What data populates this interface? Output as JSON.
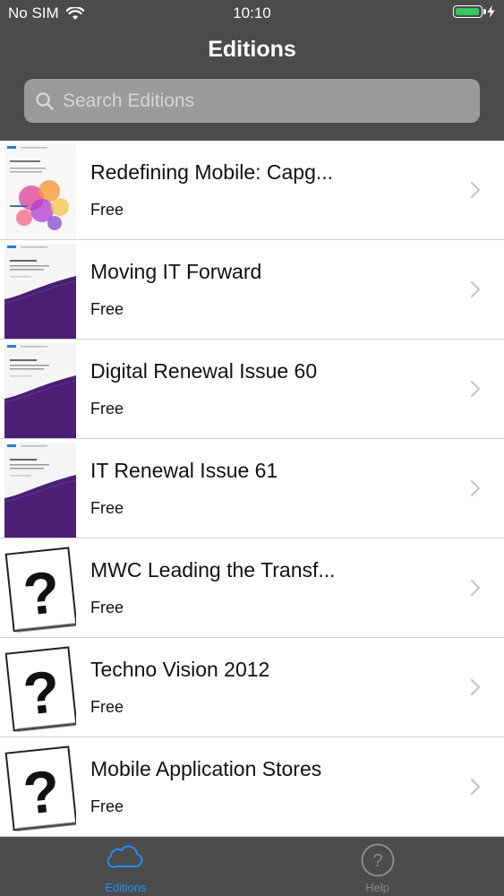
{
  "status_bar": {
    "carrier": "No SIM",
    "time": "10:10",
    "wifi_icon": "wifi-icon",
    "battery_level": 1.0,
    "battery_color": "#34c759"
  },
  "nav": {
    "title": "Editions"
  },
  "search": {
    "placeholder": "Search Editions",
    "value": ""
  },
  "editions": [
    {
      "title": "Redefining Mobile: Capg...",
      "price": "Free",
      "cover": "colorful-cover"
    },
    {
      "title": "Moving IT Forward",
      "price": "Free",
      "cover": "purple-wave-cover"
    },
    {
      "title": "Digital Renewal Issue 60",
      "price": "Free",
      "cover": "purple-wave-cover"
    },
    {
      "title": "IT Renewal Issue 61",
      "price": "Free",
      "cover": "purple-wave-cover"
    },
    {
      "title": "MWC Leading the Transf...",
      "price": "Free",
      "cover": "question-mark-placeholder"
    },
    {
      "title": "Techno Vision 2012",
      "price": "Free",
      "cover": "question-mark-placeholder"
    },
    {
      "title": "Mobile Application Stores",
      "price": "Free",
      "cover": "question-mark-placeholder"
    }
  ],
  "tabs": [
    {
      "label": "Editions",
      "icon": "cloud-icon",
      "selected": true
    },
    {
      "label": "Help",
      "icon": "help-icon",
      "selected": false
    }
  ],
  "colors": {
    "header_bg": "#4b4b4b",
    "accent": "#1e90ff",
    "cover_purple": "#4a1f74"
  }
}
